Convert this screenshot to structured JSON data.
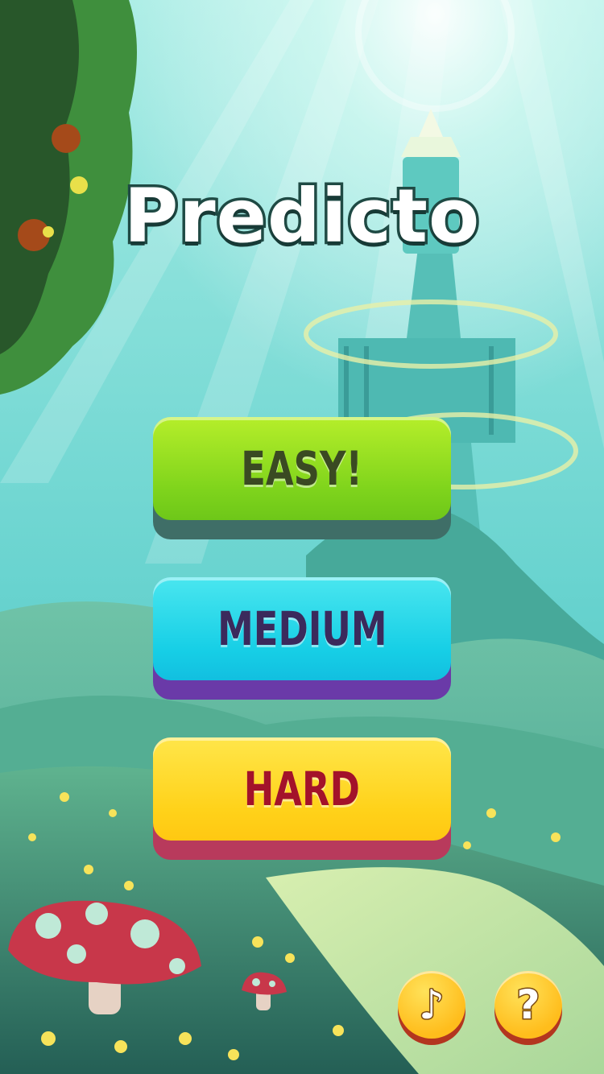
{
  "app": {
    "title": "Predicto"
  },
  "menu": {
    "easy_label": "EASY!",
    "medium_label": "MEDIUM",
    "hard_label": "HARD"
  },
  "controls": {
    "music_icon": "music-note-icon",
    "music_glyph": "♪",
    "help_icon": "question-mark-icon",
    "help_glyph": "?"
  },
  "colors": {
    "easy": "#8ad61e",
    "medium": "#19d0e6",
    "hard": "#ffd21a",
    "round_button": "#ffc21e"
  }
}
